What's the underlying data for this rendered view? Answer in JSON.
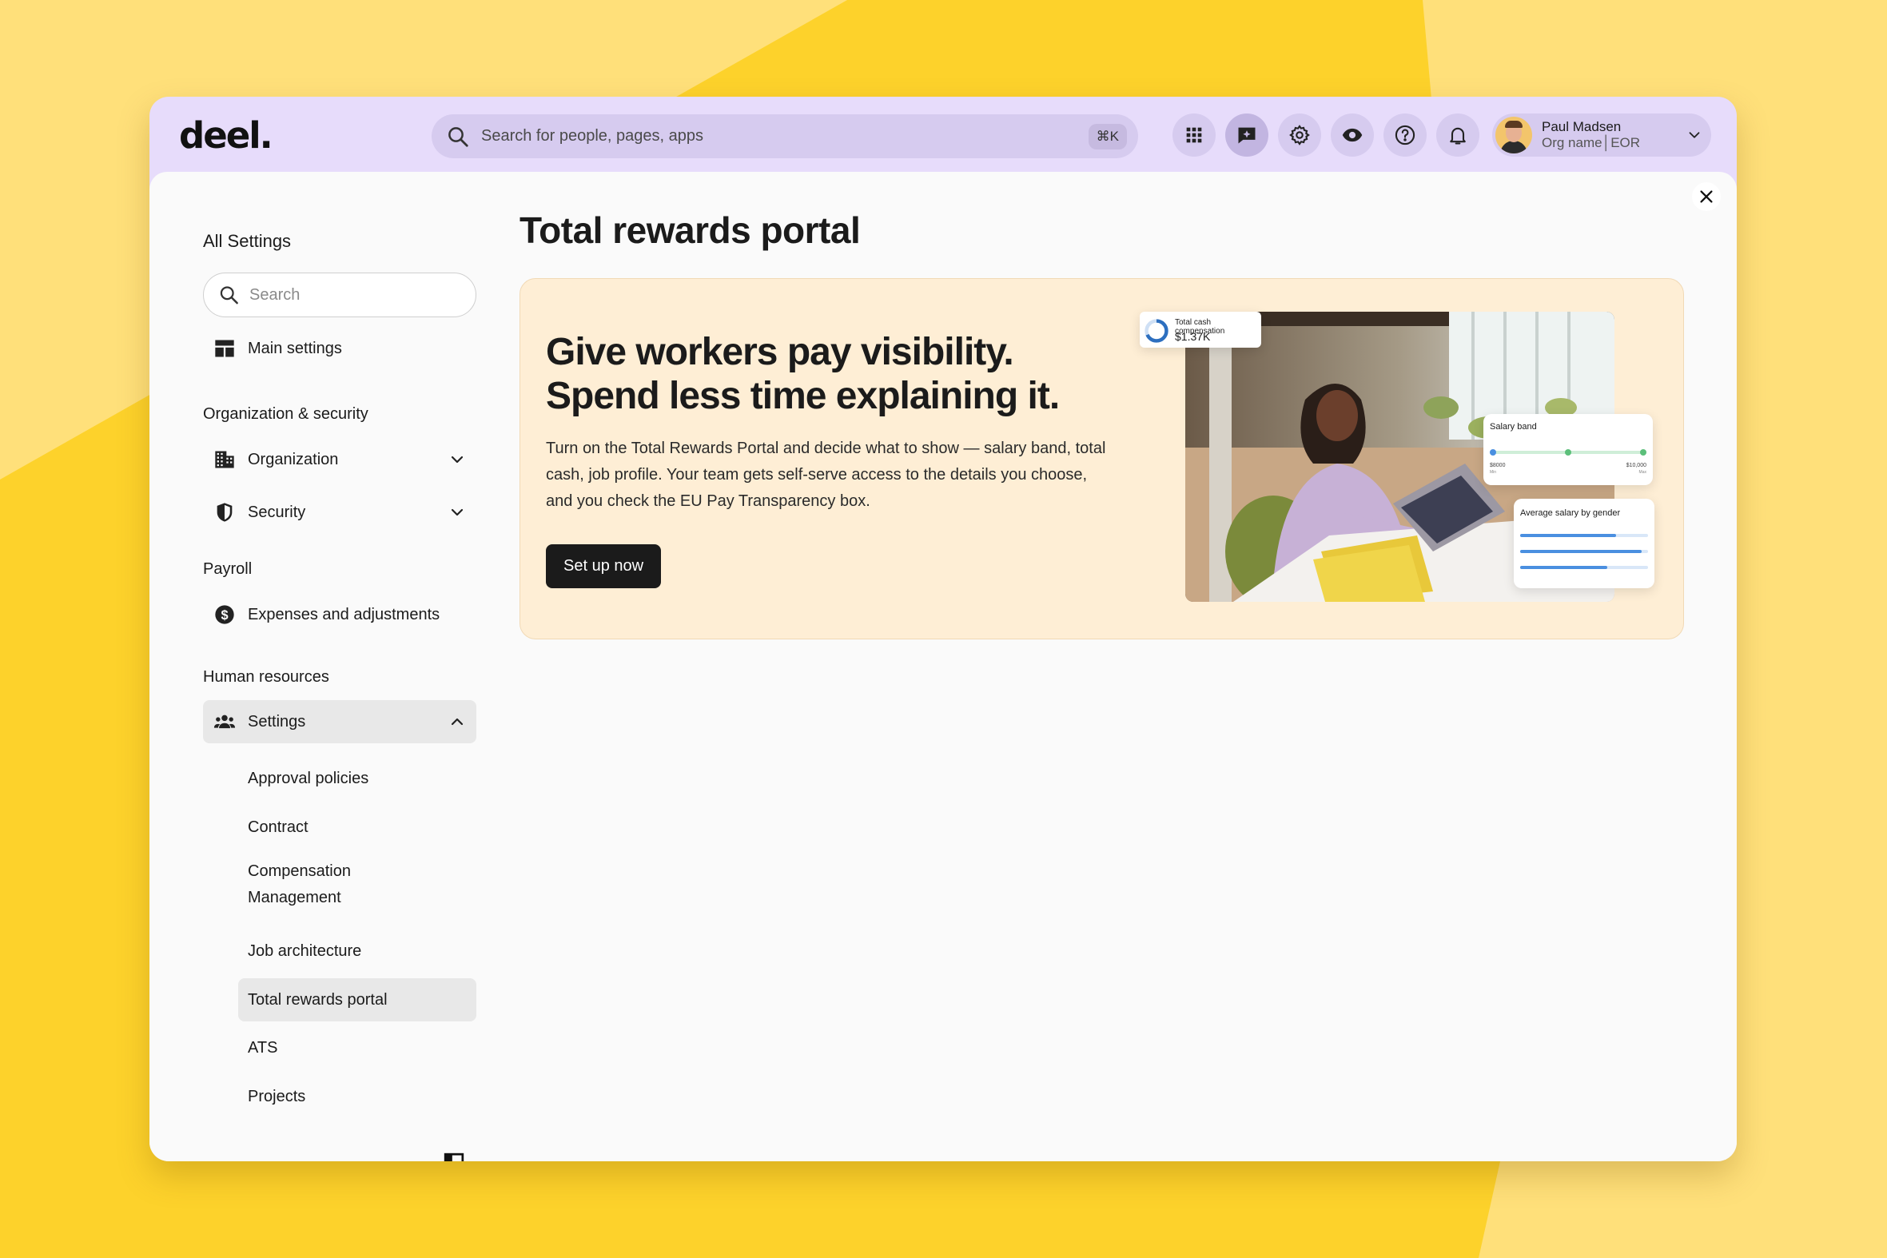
{
  "app": {
    "logo": "deel."
  },
  "topbar": {
    "search_placeholder": "Search for people, pages, apps",
    "search_shortcut": "⌘K",
    "icons": [
      "apps-grid-icon",
      "ai-chat-icon",
      "settings-gear-icon",
      "eye-icon",
      "help-icon",
      "notification-bell-icon"
    ],
    "user": {
      "name": "Paul Madsen",
      "org": "Org name│EOR"
    }
  },
  "sidebar": {
    "title": "All Settings",
    "search_placeholder": "Search",
    "main_settings": "Main settings",
    "sections": {
      "org_security": "Organization & security",
      "payroll": "Payroll",
      "hr": "Human resources"
    },
    "items": {
      "organization": "Organization",
      "security": "Security",
      "expenses": "Expenses and adjustments",
      "settings": "Settings"
    },
    "sub_items": [
      "Approval policies",
      "Contract",
      "Compensation Management",
      "Job architecture",
      "Total rewards portal",
      "ATS",
      "Projects"
    ],
    "selected_sub_item": "Total rewards portal"
  },
  "main": {
    "page_title": "Total rewards portal",
    "banner": {
      "headline": "Give workers pay visibility. Spend less time explaining it.",
      "body": "Turn on the Total Rewards Portal and decide what to show — salary band, total cash, job profile. Your team gets self-serve access to the details you choose, and you check the EU Pay Transparency box.",
      "cta_label": "Set up now",
      "illustration": {
        "cash_card_title": "Total cash compensation",
        "cash_card_value": "$1.37K",
        "salary_band_title": "Salary band",
        "salary_band_min_value": "$8000",
        "salary_band_min_label": "Min",
        "salary_band_max_value": "$10,000",
        "salary_band_max_label": "Max",
        "gender_card_title": "Average salary by gender"
      }
    }
  },
  "colors": {
    "background_yellow": "#fdd22b",
    "topbar_lavender": "#e7dcfb",
    "banner_cream": "#feeed5",
    "cta_black": "#1b1b1b",
    "chart_blue": "#4a8fe0",
    "band_green": "#5cbf7a"
  }
}
